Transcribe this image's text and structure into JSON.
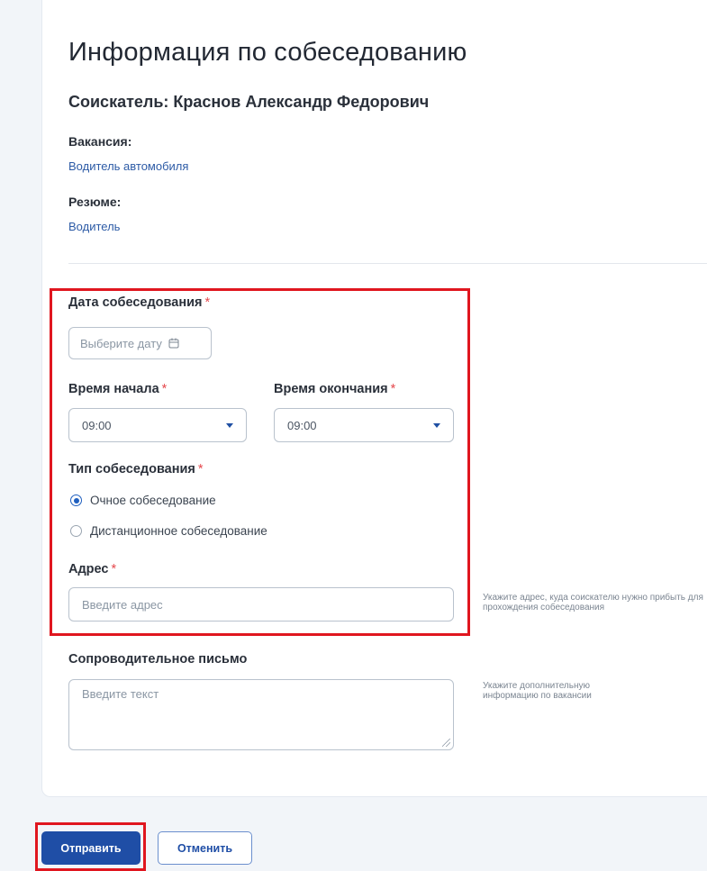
{
  "page": {
    "title": "Информация по собеседованию",
    "applicant": "Соискатель: Краснов Александр Федорович"
  },
  "vacancy": {
    "label": "Вакансия:",
    "value": "Водитель автомобиля"
  },
  "resume": {
    "label": "Резюме:",
    "value": "Водитель"
  },
  "form": {
    "required_mark": "*",
    "date": {
      "label": "Дата собеседования",
      "placeholder": "Выберите дату"
    },
    "start_time": {
      "label": "Время начала",
      "value": "09:00"
    },
    "end_time": {
      "label": "Время окончания",
      "value": "09:00"
    },
    "interview_type": {
      "label": "Тип собеседования",
      "options": [
        "Очное собеседование",
        "Дистанционное собеседование"
      ],
      "selected": "Очное собеседование"
    },
    "address": {
      "label": "Адрес",
      "placeholder": "Введите адрес",
      "hint": "Укажите адрес, куда соискателю нужно прибыть для прохождения собеседования"
    },
    "cover_letter": {
      "label": "Сопроводительное письмо",
      "placeholder": "Введите текст",
      "hint": "Укажите дополнительную информацию по вакансии"
    }
  },
  "actions": {
    "submit": "Отправить",
    "cancel": "Отменить"
  },
  "colors": {
    "accent": "#1f4ea6",
    "link": "#2d5ba6",
    "highlight": "#e0161f",
    "required": "#e5484d"
  }
}
